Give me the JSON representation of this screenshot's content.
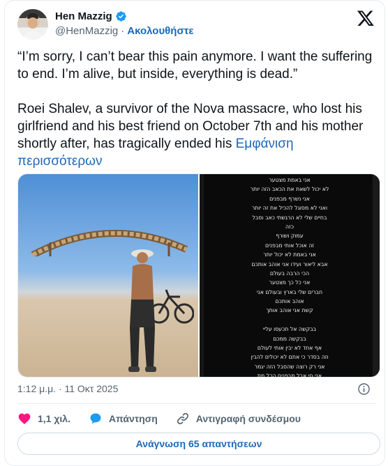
{
  "author": {
    "name": "Hen Mazzig",
    "handle": "@HenMazzig",
    "separator": "·",
    "follow_label": "Ακολουθήστε",
    "avatar_icon": "profile-photo",
    "verified_icon": "verified-badge-icon"
  },
  "brand": {
    "logo_icon": "x-logo-icon",
    "accent_color": "#1d68b8",
    "like_color": "#f91880"
  },
  "tweet": {
    "paragraph1": "“I’m sorry, I can’t bear this pain anymore. I want the suffering to end. I’m alive, but inside, everything is dead.”",
    "paragraph2": "Roei Shalev, a survivor of the Nova massacre, who lost his girlfriend and his best friend on October 7th and his mother shortly after, has tragically ended his ",
    "show_more": "Εμφάνιση περισσότερων"
  },
  "media": {
    "photo_icon": "man-at-festival-photo",
    "story_lines": [
      "אני באמת מצטער",
      "לא יכול לשאת את הכאב הזה יותר",
      "אני נשרף מבפנים",
      "ואני לא מסוגל להכיל את זה יותר",
      "בחיים שלי לא הרגשתי כאב וסבל",
      "כזה",
      "עמוק ושורף",
      "זה אוכל אותי מבפנים",
      "אני באמת לא יכול יותר",
      "אבא ליאור ועידו אני אוהב אותכם",
      "הכי הרבה בעולם",
      "אני כל כך מצטער",
      "חברים שלי בארץ ובעולם אני",
      "אוהב אותכם",
      "קשת אני אוהב אותך",
      "",
      "בבקשה אל תכעסו עליי",
      "בבקשה ממכם",
      "אף אחד לא יבין אותי לעולם",
      "וזה בסדר כי אתם לא יכולים להבין",
      "אני רק רוצה שהסבל הזה יגמר",
      "אני חי אבל מבפנים הכל מת",
      "",
      "בבקשה תזכרו לי את הטוב",
      "תעשו מסיבה לכבודי"
    ]
  },
  "meta": {
    "timestamp": "1:12 μ.μ. · 11 Οκτ 2025",
    "info_icon": "info-icon"
  },
  "actions": {
    "like_count": "1,1 χιλ.",
    "like_icon": "heart-icon",
    "reply_label": "Απάντηση",
    "reply_icon": "reply-bubble-icon",
    "copy_link_label": "Αντιγραφή συνδέσμου",
    "copy_link_icon": "link-icon"
  },
  "read_replies_label": "Ανάγνωση 65 απαντήσεων"
}
